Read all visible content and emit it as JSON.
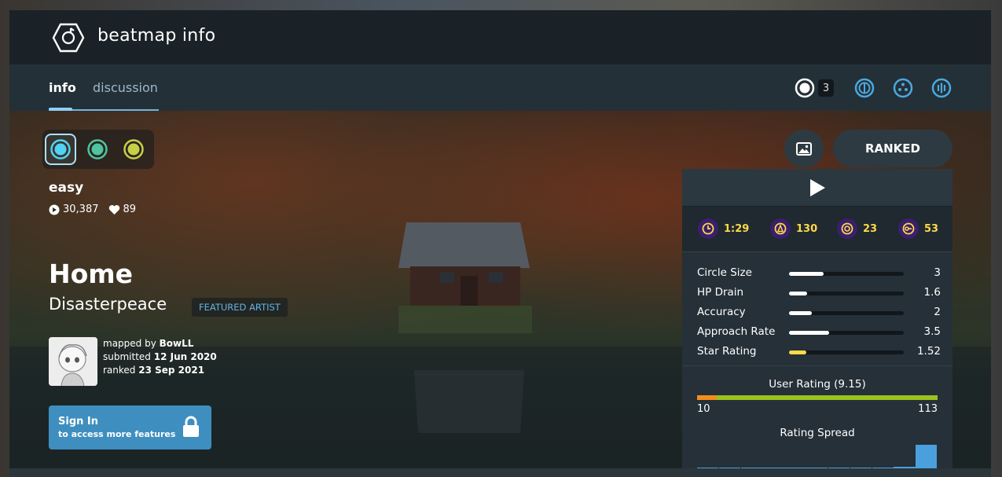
{
  "header": {
    "title": "beatmap info"
  },
  "tabs": {
    "info": "info",
    "discussion": "discussion"
  },
  "modes": {
    "count": "3"
  },
  "difficulty": {
    "name": "easy",
    "play_count": "30,387",
    "favourites": "89"
  },
  "song": {
    "title": "Home",
    "artist": "Disasterpeace",
    "featured_label": "FEATURED ARTIST"
  },
  "mapper": {
    "mapped_by_label": "mapped by",
    "name": "BowLL",
    "submitted_label": "submitted",
    "submitted_date": "12 Jun 2020",
    "ranked_label": "ranked",
    "ranked_date": "23 Sep 2021"
  },
  "signin": {
    "title": "Sign In",
    "subtitle": "to access more features"
  },
  "status": "RANKED",
  "mini_stats": {
    "length": "1:29",
    "bpm": "130",
    "circles": "23",
    "sliders": "53"
  },
  "attributes": [
    {
      "label": "Circle Size",
      "value": "3",
      "fill": 0.3
    },
    {
      "label": "HP Drain",
      "value": "1.6",
      "fill": 0.16
    },
    {
      "label": "Accuracy",
      "value": "2",
      "fill": 0.2
    },
    {
      "label": "Approach Rate",
      "value": "3.5",
      "fill": 0.35
    },
    {
      "label": "Star Rating",
      "value": "1.52",
      "fill": 0.15
    }
  ],
  "user_rating": {
    "title": "User Rating (9.15)",
    "negative": "10",
    "positive": "113",
    "negative_fraction": 0.081
  },
  "rating_spread": {
    "title": "Rating Spread",
    "levels": [
      0.03,
      0.0,
      0.0,
      0.0,
      0.0,
      0.0,
      0.0,
      0.0,
      0.05,
      0.07,
      1.0
    ]
  },
  "colors": {
    "accent_blue": "#62b3e6",
    "star_yellow": "#ffd949",
    "rating_green": "#9ac31d",
    "rating_orange": "#f28e1c"
  }
}
